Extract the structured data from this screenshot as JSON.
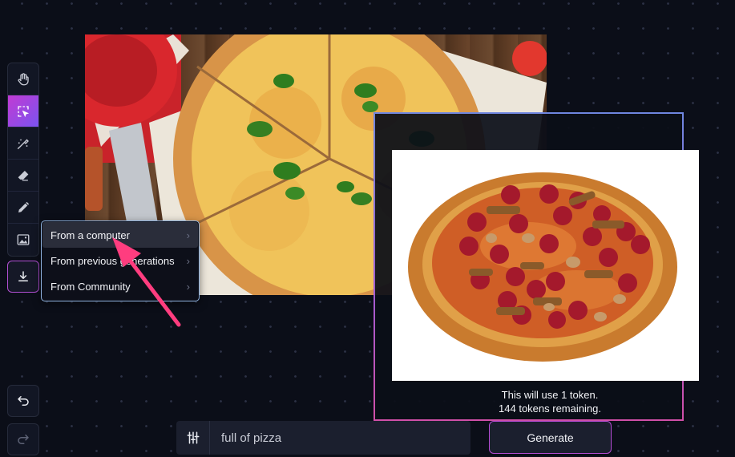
{
  "toolbar": {
    "tools": [
      {
        "icon": "hand-icon",
        "active": false
      },
      {
        "icon": "select-icon",
        "active": true
      },
      {
        "icon": "magic-brush-icon",
        "active": false
      },
      {
        "icon": "eraser-icon",
        "active": false
      },
      {
        "icon": "pencil-icon",
        "active": false
      },
      {
        "icon": "image-icon",
        "active": false
      }
    ],
    "upload_icon": "download-icon",
    "undo_icon": "undo-icon",
    "redo_icon": "redo-icon"
  },
  "upload_menu": {
    "items": [
      {
        "label": "From a computer"
      },
      {
        "label": "From previous generations"
      },
      {
        "label": "From Community"
      }
    ]
  },
  "generation": {
    "token_line1": "This will use 1 token.",
    "token_line2": "144 tokens remaining."
  },
  "prompt": {
    "value": "full of pizza",
    "settings_icon": "sliders-icon"
  },
  "generate_button": {
    "label": "Generate"
  },
  "colors": {
    "accent_gradient_start": "#c13bd3",
    "accent_gradient_end": "#7b53f0",
    "arrow": "#ff3d7f",
    "background": "#0b0e18"
  }
}
